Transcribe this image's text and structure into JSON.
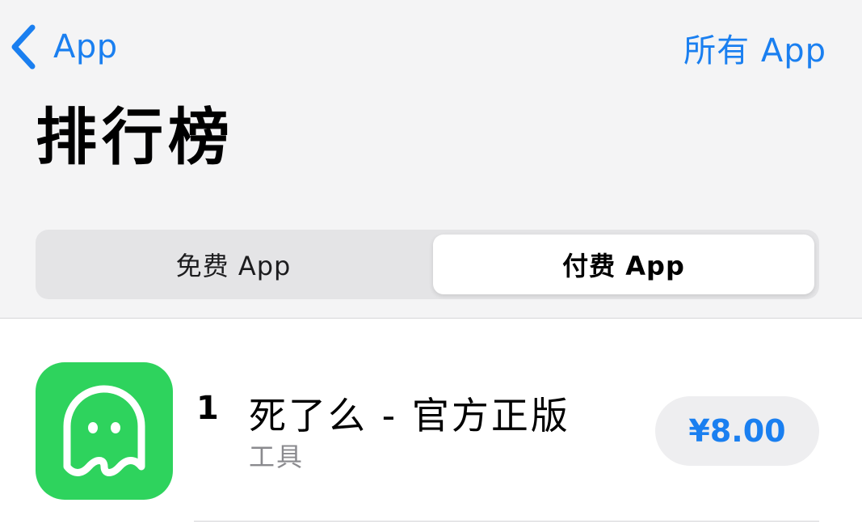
{
  "nav": {
    "back_label": "App",
    "all_apps_label": "所有 App"
  },
  "page": {
    "title": "排行榜"
  },
  "segments": {
    "free_label": "免费 App",
    "paid_label": "付费 App",
    "selected": "paid"
  },
  "apps": [
    {
      "rank": "1",
      "name": "死了么 - 官方正版",
      "category": "工具",
      "price": "¥8.00",
      "icon": "ghost-icon"
    }
  ],
  "colors": {
    "accent": "#1a7ff0",
    "app_icon_bg": "#2ed35d",
    "header_bg": "#f4f4f5",
    "segment_bg": "#e4e4e6",
    "price_button_bg": "#eeeef0",
    "secondary_text": "#8a8a8e"
  }
}
